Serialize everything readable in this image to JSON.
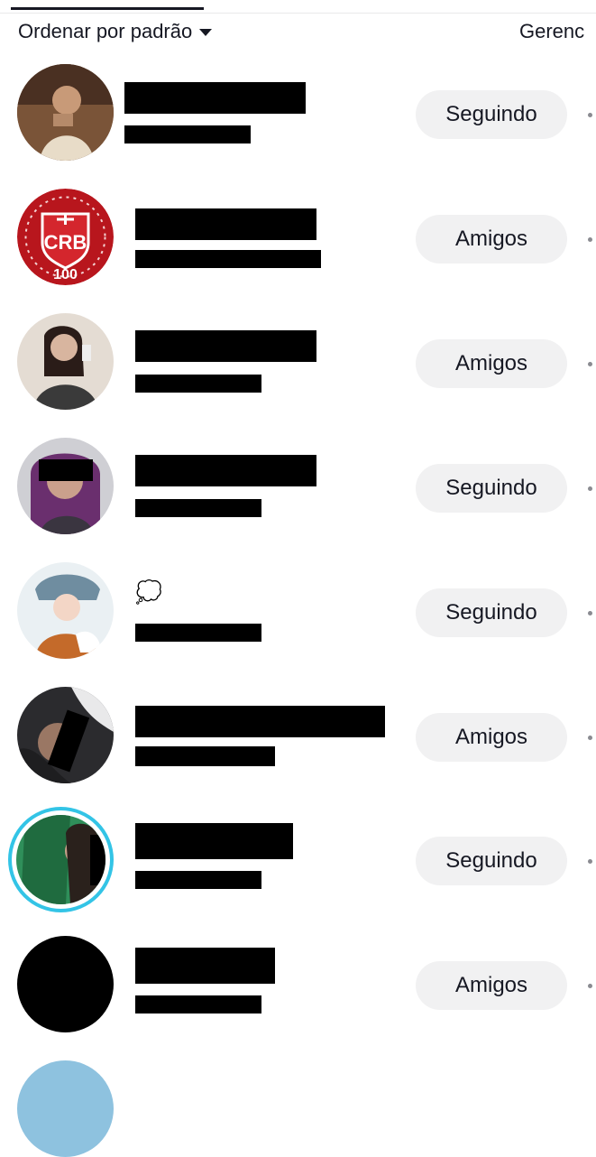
{
  "tabs": {
    "active_indicator": true
  },
  "sort": {
    "label": "Ordenar por padrão",
    "icon": "caret-down-icon"
  },
  "header": {
    "manage_label": "Gerenc"
  },
  "rows": [
    {
      "avatar": "avatar-photo",
      "name": "",
      "username": "",
      "button_label": "Seguindo"
    },
    {
      "avatar": "crb-club-logo",
      "name": "",
      "username": "",
      "button_label": "Amigos"
    },
    {
      "avatar": "avatar-photo",
      "name": "",
      "username": "",
      "button_label": "Amigos"
    },
    {
      "avatar": "avatar-photo",
      "name": "",
      "username": "",
      "button_label": "Seguindo"
    },
    {
      "avatar": "avatar-illustration",
      "name": "💭",
      "username": "",
      "button_label": "Seguindo"
    },
    {
      "avatar": "avatar-photo",
      "name": "",
      "username": "",
      "button_label": "Amigos"
    },
    {
      "avatar": "avatar-photo-with-story-ring",
      "name": "",
      "username": "",
      "button_label": "Seguindo"
    },
    {
      "avatar": "avatar-black",
      "name": "",
      "username": "",
      "button_label": "Amigos"
    }
  ],
  "logo": {
    "text": "CRB",
    "number": "100"
  },
  "colors": {
    "button_bg": "#f1f1f2",
    "story_ring": "#33c4e6",
    "text": "#161823"
  }
}
